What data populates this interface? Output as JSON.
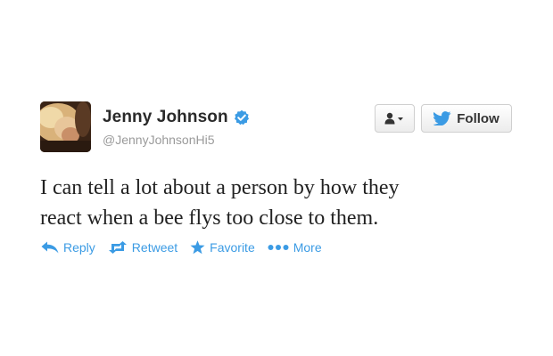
{
  "user": {
    "full_name": "Jenny Johnson",
    "handle": "@JennyJohnsonHi5",
    "verified": true
  },
  "buttons": {
    "user_menu_icon": "person-dropdown-icon",
    "follow_label": "Follow",
    "follow_icon": "twitter-bird-icon"
  },
  "tweet": {
    "lines": [
      "I can tell a lot about a person by how they",
      "react when a bee flys too close to them."
    ]
  },
  "actions": [
    {
      "label": "Reply",
      "icon": "reply-icon"
    },
    {
      "label": "Retweet",
      "icon": "retweet-icon"
    },
    {
      "label": "Favorite",
      "icon": "star-icon"
    },
    {
      "label": "More",
      "icon": "ellipsis-icon"
    }
  ],
  "colors": {
    "link_blue": "#3b9be4",
    "verified_blue": "#3b9be4",
    "text": "#222222",
    "handle_gray": "#9a9a9a"
  }
}
